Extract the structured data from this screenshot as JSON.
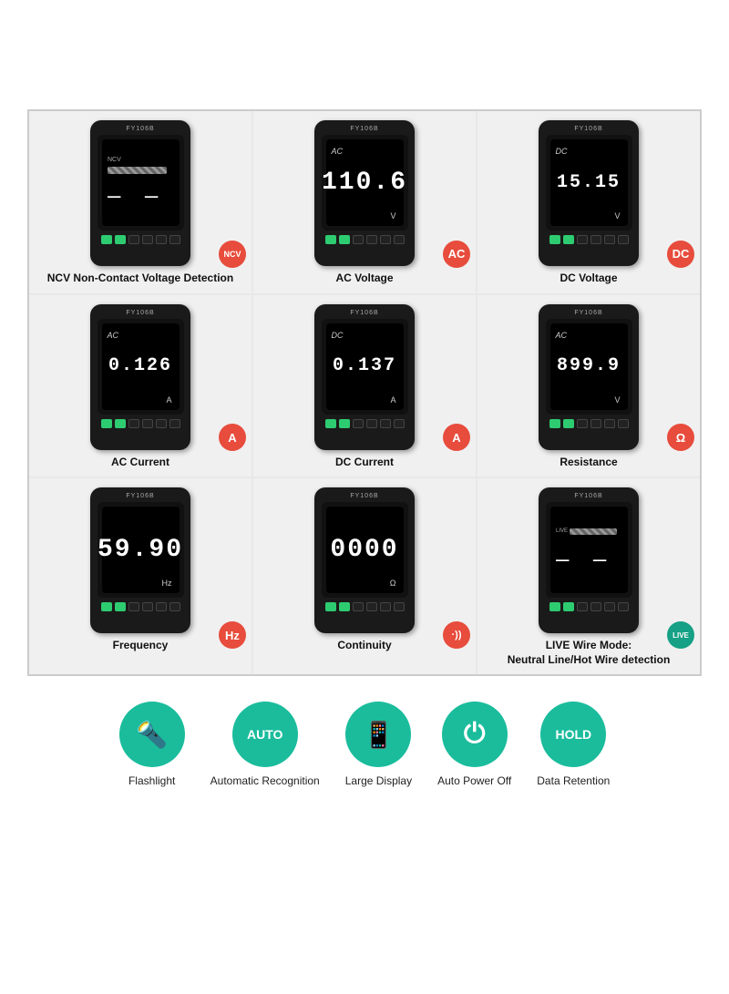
{
  "model": "FY106B",
  "cells": [
    {
      "id": "ncv",
      "display_type": "ncv",
      "display_value": "— —",
      "unit": "",
      "prefix": "NCV",
      "badge_text": "NCV",
      "badge_color": "badge-red",
      "label": "NCV Non-Contact Voltage Detection"
    },
    {
      "id": "ac-voltage",
      "display_type": "number",
      "display_value": "110.6",
      "unit": "V",
      "prefix": "AC",
      "badge_text": "AC",
      "badge_color": "badge-red",
      "label": "AC Voltage"
    },
    {
      "id": "dc-voltage",
      "display_type": "number",
      "display_value": "15.15",
      "unit": "V",
      "prefix": "DC",
      "badge_text": "DC",
      "badge_color": "badge-red",
      "label": "DC Voltage"
    },
    {
      "id": "ac-current",
      "display_type": "number",
      "display_value": "0.126",
      "unit": "A",
      "prefix": "AC",
      "badge_text": "A",
      "badge_color": "badge-red",
      "label": "AC Current"
    },
    {
      "id": "dc-current",
      "display_type": "number",
      "display_value": "0.137",
      "unit": "A",
      "prefix": "DC",
      "badge_text": "A",
      "badge_color": "badge-red",
      "label": "DC Current"
    },
    {
      "id": "resistance",
      "display_type": "number",
      "display_value": "899.9",
      "unit": "V",
      "prefix": "AC",
      "badge_text": "Ω",
      "badge_color": "badge-red",
      "label": "Resistance"
    },
    {
      "id": "frequency",
      "display_type": "number",
      "display_value": "59.90",
      "unit": "Hz",
      "prefix": "",
      "badge_text": "Hz",
      "badge_color": "badge-red",
      "label": "Frequency"
    },
    {
      "id": "continuity",
      "display_type": "number",
      "display_value": "0000",
      "unit": "Ω",
      "prefix": "",
      "badge_text": "·))",
      "badge_color": "badge-red",
      "label": "Continuity"
    },
    {
      "id": "live-wire",
      "display_type": "live",
      "display_value": "— —",
      "unit": "",
      "prefix": "LIVE",
      "badge_text": "LIVE",
      "badge_color": "badge-teal",
      "label": "LIVE Wire Mode:\nNeutral Line/Hot Wire detection"
    }
  ],
  "features": [
    {
      "id": "flashlight",
      "icon_type": "flashlight",
      "icon_text": "🔦",
      "label": "Flashlight"
    },
    {
      "id": "auto-recognition",
      "icon_type": "text",
      "icon_text": "AUTO",
      "label": "Automatic Recognition"
    },
    {
      "id": "large-display",
      "icon_type": "display",
      "icon_text": "📱",
      "label": "Large Display"
    },
    {
      "id": "auto-power-off",
      "icon_type": "power",
      "icon_text": "⏻",
      "label": "Auto Power Off"
    },
    {
      "id": "data-retention",
      "icon_type": "text",
      "icon_text": "HOLD",
      "label": "Data Retention"
    }
  ]
}
